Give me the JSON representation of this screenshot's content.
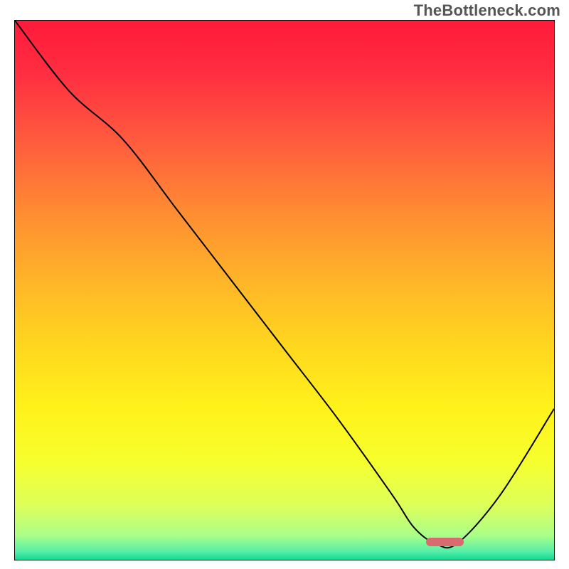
{
  "watermark": "TheBottleneck.com",
  "colors": {
    "curve": "#000000",
    "frame": "#000000",
    "marker": "#d96a6f"
  },
  "gradient_stops": [
    {
      "offset": 0.0,
      "color": "#ff1a3a"
    },
    {
      "offset": 0.1,
      "color": "#ff2f41"
    },
    {
      "offset": 0.22,
      "color": "#ff5a3e"
    },
    {
      "offset": 0.35,
      "color": "#ff8a33"
    },
    {
      "offset": 0.48,
      "color": "#ffb428"
    },
    {
      "offset": 0.6,
      "color": "#ffd61f"
    },
    {
      "offset": 0.72,
      "color": "#fff21a"
    },
    {
      "offset": 0.82,
      "color": "#f6ff2e"
    },
    {
      "offset": 0.9,
      "color": "#ddff5a"
    },
    {
      "offset": 0.955,
      "color": "#aaff88"
    },
    {
      "offset": 0.985,
      "color": "#55eeaa"
    },
    {
      "offset": 1.0,
      "color": "#11d98f"
    }
  ],
  "chart_data": {
    "type": "line",
    "title": "",
    "xlabel": "",
    "ylabel": "",
    "xlim": [
      0,
      100
    ],
    "ylim": [
      0,
      100
    ],
    "axes_visible": false,
    "grid": false,
    "marker": {
      "x_start": 76,
      "x_end": 83,
      "y": 3.5,
      "thickness": 1.6
    },
    "series": [
      {
        "name": "bottleneck-curve",
        "x": [
          0,
          10,
          20,
          30,
          40,
          50,
          60,
          70,
          74,
          78,
          82,
          90,
          100
        ],
        "y": [
          100,
          87,
          78,
          65,
          52,
          39,
          26,
          12,
          6,
          3,
          3,
          12,
          28
        ]
      }
    ]
  }
}
